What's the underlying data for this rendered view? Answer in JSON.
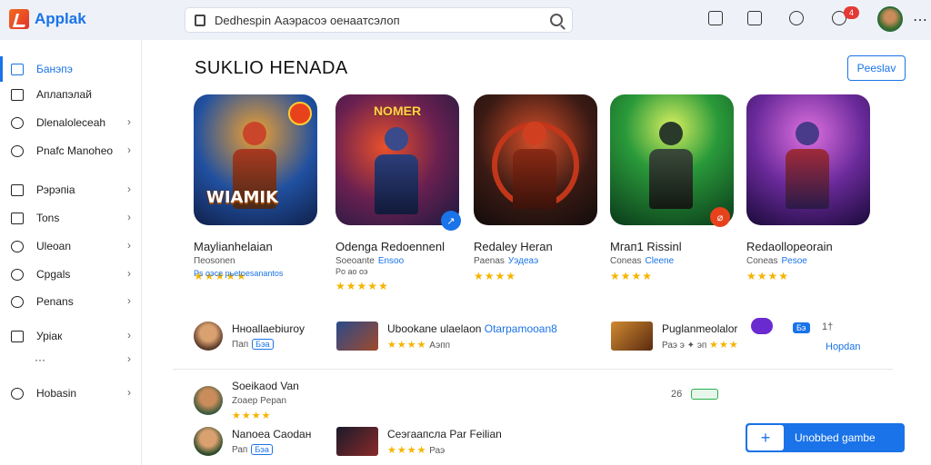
{
  "app": {
    "name": "Applak"
  },
  "search": {
    "value": "Dedhespin Ааэрасоэ оенаатсэлоп"
  },
  "topbar": {
    "notification_count": "4"
  },
  "sidebar": {
    "items": [
      {
        "label": "Банэпэ",
        "icon": "home-icon",
        "active": true
      },
      {
        "label": "Аплапэлай",
        "icon": "monitor-icon"
      },
      {
        "label": "Dlenaloleceah",
        "icon": "time-icon"
      },
      {
        "label": "Pnafc Manoheo",
        "icon": "wifi-icon"
      },
      {
        "label": "Рэрэпіа",
        "icon": "document-icon"
      },
      {
        "label": "Tons",
        "icon": "plug-icon"
      },
      {
        "label": "Uleoan",
        "icon": "bell-icon"
      },
      {
        "label": "Cpgals",
        "icon": "target-icon"
      },
      {
        "label": "Penans",
        "icon": "search-icon"
      },
      {
        "label": "Уріак",
        "icon": "building-icon"
      },
      {
        "label": "···",
        "icon": ""
      },
      {
        "label": "Hobasin",
        "icon": "info-icon"
      }
    ]
  },
  "main": {
    "section_title": "SUKLIO HENADA",
    "section_button": "Peeslav",
    "cards": [
      {
        "title": "Мауlianhelaian",
        "sub": "Пеоsonen",
        "sub2": "Ps оэсе рьеtoesanantos",
        "stars": "★★★★★",
        "logo": "WIAMIK",
        "badge": ""
      },
      {
        "title": "Odenga Redoennenl",
        "sub": "Soeoante",
        "tag": "Ensoo",
        "sub2": "Po ао оэ",
        "stars": "★★★★★",
        "logo_top": "NOMER",
        "badge": "↗"
      },
      {
        "title": "Redaley Heran",
        "sub": "Paenas",
        "tag": "Уэдеаэ",
        "stars": "★★★★",
        "badge": ""
      },
      {
        "title": "Мгап1 Rissinl",
        "sub": "Coneas",
        "tag": "Cleene",
        "stars": "★★★★",
        "badge": "⌀"
      },
      {
        "title": "Redaollopeorain",
        "sub": "Coneas",
        "tag": "Pesoe",
        "stars": "★★★★",
        "badge": ""
      }
    ],
    "list_rows": [
      {
        "title": "Hноаllaebiuroy",
        "sub": "Пап",
        "tag": "Бэа",
        "thumb": "person"
      },
      {
        "title": "Ubookane ulaelaon",
        "tag_inline": "Otarpamooan8",
        "sub": "Аэпп",
        "stars": "★★★★",
        "thumb": "game"
      },
      {
        "title": "Puglanmeolalor",
        "sub": "Раэ э ✦ эп",
        "stars": "★★★",
        "thumb": "gamebox"
      },
      {
        "title": "Hopdan",
        "tag": "Бэ",
        "count": "1†",
        "thumb": "badge"
      }
    ],
    "list_rows2": [
      {
        "title": "Soeikaod Van",
        "sub": "Zoaep Pepan",
        "stars": "★★★★",
        "count": "26",
        "thumb": "person"
      },
      {
        "title": "Nanoea Caodaн",
        "sub": "Рап",
        "tag": "Бэа",
        "thumb": "person"
      },
      {
        "title": "Сеэгаапсла Par Feilian",
        "sub": "Раэ",
        "stars": "★★★★",
        "thumb": "game"
      }
    ],
    "primary_button": "Unobbed gambe"
  },
  "colors": {
    "accent": "#1a73e8",
    "star": "#f5b400",
    "badge_red": "#e53935"
  }
}
